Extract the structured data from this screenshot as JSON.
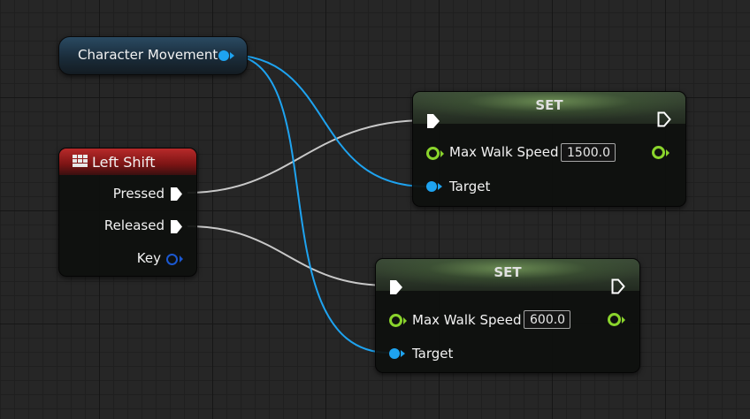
{
  "getter": {
    "label": "Character Movement"
  },
  "event": {
    "title": "Left Shift",
    "pins": {
      "pressed": "Pressed",
      "released": "Released",
      "key": "Key"
    },
    "colors": {
      "header": "#b82a2a"
    }
  },
  "set_nodes": [
    {
      "title": "SET",
      "property": "Max Walk Speed",
      "value": "1500.0",
      "target": "Target"
    },
    {
      "title": "SET",
      "property": "Max Walk Speed",
      "value": "600.0",
      "target": "Target"
    }
  ],
  "colors": {
    "object_pin": "#1ea3f0",
    "float_pin": "#8ad42c",
    "exec_wire": "#c8c8c8",
    "struct_pin": "#1b58d0"
  },
  "icons": {
    "event": "keyboard-icon"
  }
}
